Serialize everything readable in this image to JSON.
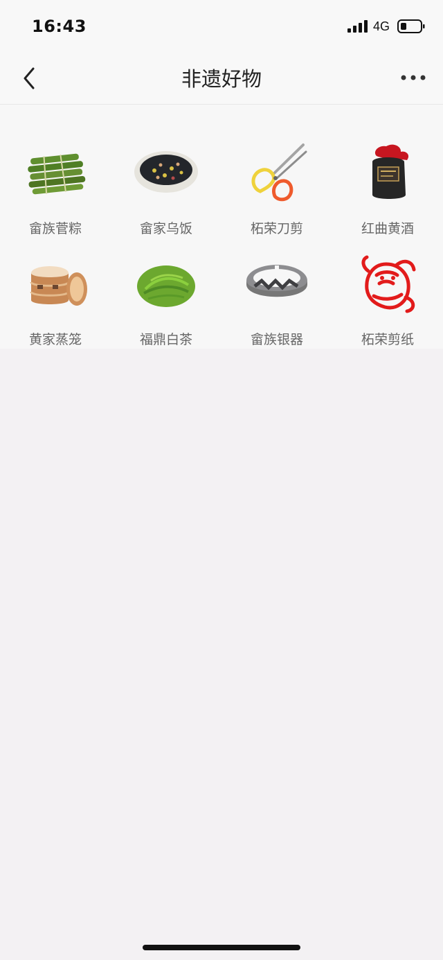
{
  "status": {
    "time": "16:43",
    "network": "4G"
  },
  "navbar": {
    "title": "非遗好物",
    "back_icon": "chevron-left-icon",
    "more_icon": "more-horizontal-icon"
  },
  "items": [
    {
      "label": "畲族菅粽",
      "icon": "zongzi-image"
    },
    {
      "label": "畲家乌饭",
      "icon": "black-rice-image"
    },
    {
      "label": "柘荣刀剪",
      "icon": "scissors-image"
    },
    {
      "label": "红曲黄酒",
      "icon": "wine-jar-image"
    },
    {
      "label": "黄家蒸笼",
      "icon": "steamer-image"
    },
    {
      "label": "福鼎白茶",
      "icon": "tea-leaves-image"
    },
    {
      "label": "畲族银器",
      "icon": "silver-bracelet-image"
    },
    {
      "label": "柘荣剪纸",
      "icon": "paper-cut-image"
    }
  ]
}
